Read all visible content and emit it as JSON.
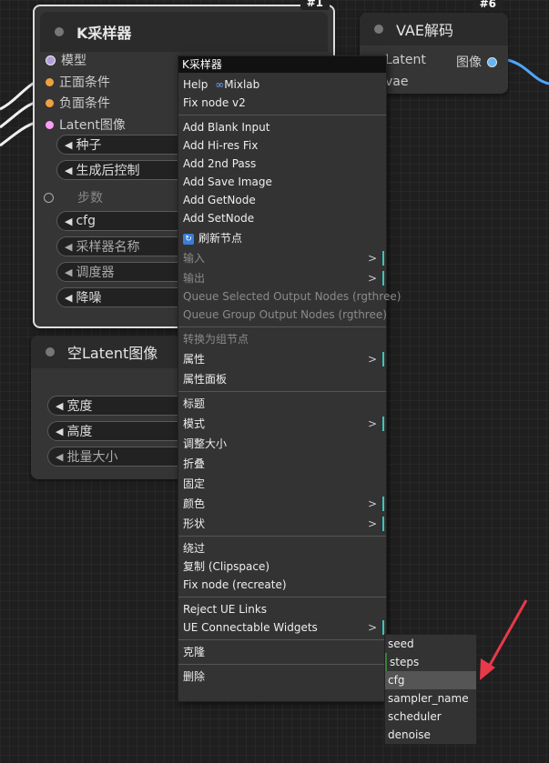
{
  "ksampler": {
    "badge": "#1",
    "title": "K采样器",
    "inputs": [
      "模型",
      "正面条件",
      "负面条件",
      "Latent图像"
    ],
    "widgets": [
      "种子",
      "生成后控制",
      "步数",
      "cfg",
      "采样器名称",
      "调度器",
      "降噪"
    ]
  },
  "vae": {
    "badge": "#6",
    "title": "VAE解码",
    "input1": "Latent",
    "input2": "vae",
    "output": "图像"
  },
  "empty_latent": {
    "title": "空Latent图像",
    "widgets": [
      "宽度",
      "高度",
      "批量大小"
    ]
  },
  "menu": {
    "header": "K采样器",
    "help_prefix": "Help",
    "help_link": "Mixlab",
    "fix_v2": "Fix node v2",
    "items_a": [
      "Add Blank Input",
      "Add Hi-res Fix",
      "Add 2nd Pass",
      "Add Save Image",
      "Add GetNode",
      "Add SetNode"
    ],
    "refresh": "刷新节点",
    "input": "输入",
    "output": "输出",
    "queue_selected": "Queue Selected Output Nodes (rgthree)",
    "queue_group": "Queue Group Output Nodes (rgthree)",
    "to_group": "转换为组节点",
    "props": "属性",
    "props_panel": "属性面板",
    "title_item": "标题",
    "mode": "模式",
    "resize": "调整大小",
    "collapse": "折叠",
    "pin": "固定",
    "color": "颜色",
    "shape": "形状",
    "bypass": "绕过",
    "copy_clip": "复制 (Clipspace)",
    "fix_recreate": "Fix node (recreate)",
    "reject_ue": "Reject UE Links",
    "ue_widgets": "UE Connectable Widgets",
    "clone": "克隆",
    "delete": "删除",
    "arrow": ">"
  },
  "submenu": {
    "items": [
      "seed",
      "steps",
      "cfg",
      "sampler_name",
      "scheduler",
      "denoise"
    ],
    "active_index": 2
  },
  "colors": {
    "accent": "#39c5bb",
    "link_blue": "#4da6ff",
    "annotation_red": "#e8394a"
  }
}
